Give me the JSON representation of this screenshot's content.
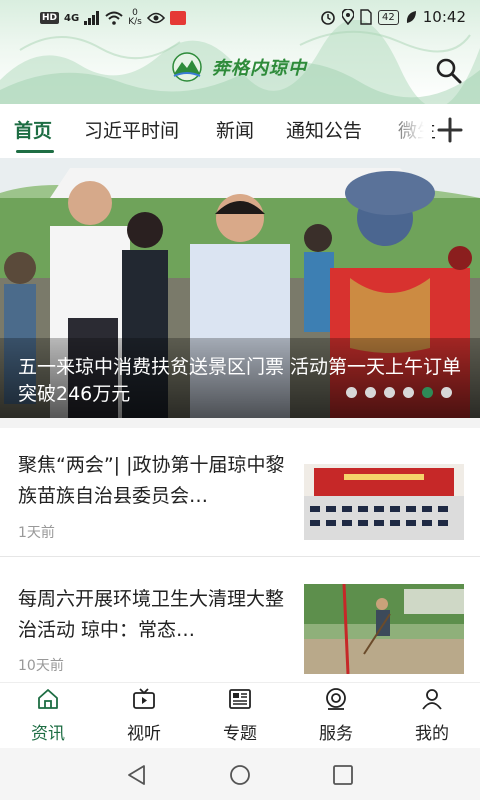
{
  "status_bar": {
    "network_badge": "HD",
    "signal": "4G",
    "speed_value": "0",
    "speed_unit": "K/s",
    "battery": "42",
    "time": "10:42"
  },
  "header": {
    "logo_text": "奔格内琼中",
    "search_icon": "search-icon"
  },
  "tabs": [
    {
      "label": "首页",
      "active": true
    },
    {
      "label": "习近平时间",
      "active": false
    },
    {
      "label": "新闻",
      "active": false
    },
    {
      "label": "通知公告",
      "active": false
    },
    {
      "label": "微生",
      "active": false
    }
  ],
  "banner": {
    "title": "五一来琼中消费扶贫送景区门票 活动第一天上午订单突破246万元",
    "dot_count": 6,
    "active_dot_index": 4
  },
  "news": [
    {
      "title": "聚焦“两会”| |政协第十届琼中黎族苗族自治县委员会…",
      "time": "1天前"
    },
    {
      "title": "每周六开展环境卫生大清理大整治活动 琼中：常态…",
      "time": "10天前"
    }
  ],
  "bottom_nav": [
    {
      "label": "资讯",
      "icon": "home-icon",
      "active": true
    },
    {
      "label": "视听",
      "icon": "video-icon",
      "active": false
    },
    {
      "label": "专题",
      "icon": "newspaper-icon",
      "active": false
    },
    {
      "label": "服务",
      "icon": "service-icon",
      "active": false
    },
    {
      "label": "我的",
      "icon": "user-icon",
      "active": false
    }
  ],
  "colors": {
    "accent": "#1d6d43",
    "logo_green": "#2e8b3a",
    "text": "#222222",
    "muted": "#999999"
  }
}
